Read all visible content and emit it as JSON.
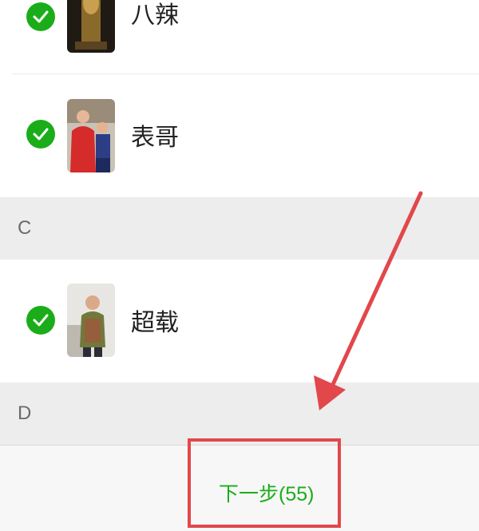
{
  "contacts": [
    {
      "name": "八辣",
      "selected": true
    },
    {
      "name": "表哥",
      "selected": true
    },
    {
      "name": "超载",
      "selected": true
    }
  ],
  "sections": [
    {
      "letter": "C"
    },
    {
      "letter": "D"
    }
  ],
  "footer": {
    "next_label": "下一步(55)"
  },
  "colors": {
    "accent_green": "#1aad19",
    "highlight_red": "#e2474b",
    "section_bg": "#ededed"
  },
  "icons": [
    "checkmark-icon",
    "contact-avatar",
    "annotation-arrow"
  ]
}
